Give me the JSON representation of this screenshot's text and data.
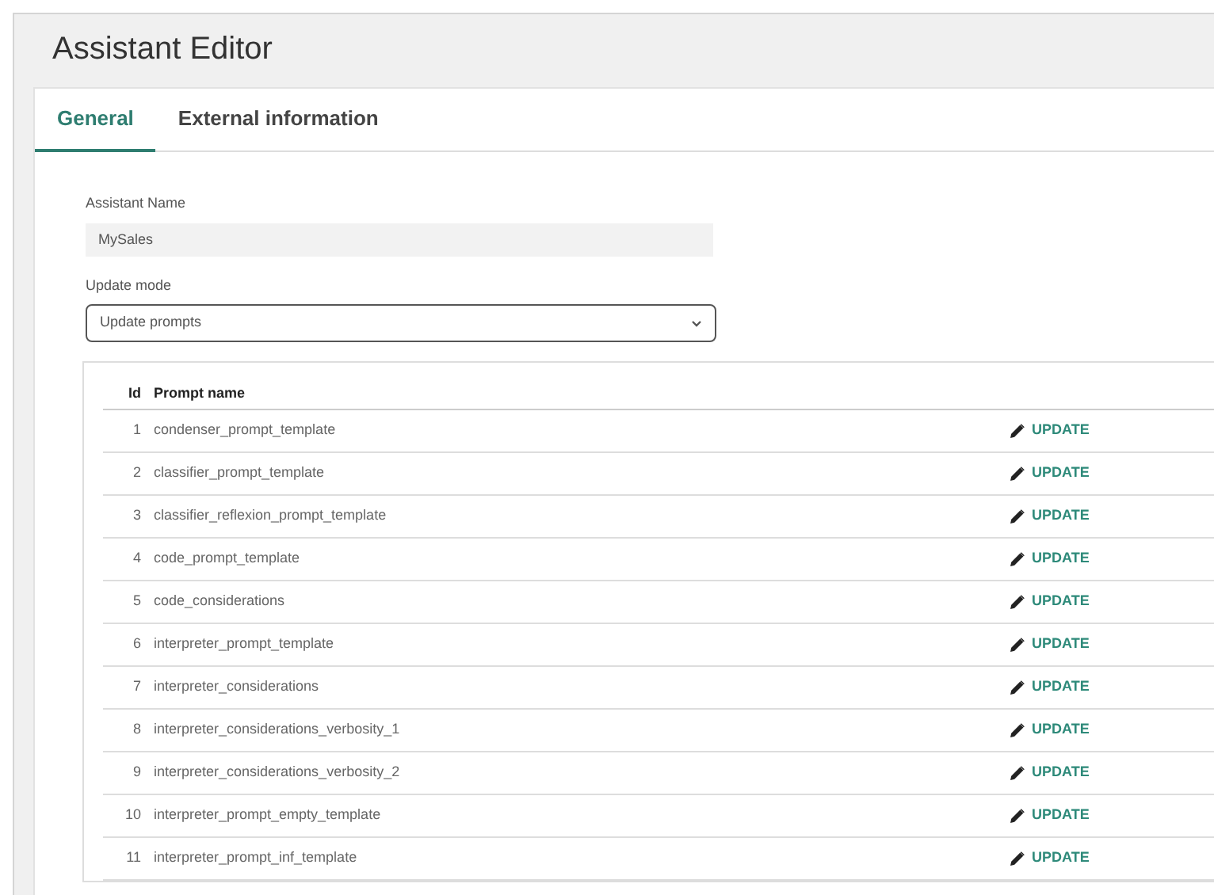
{
  "page": {
    "title": "Assistant Editor"
  },
  "tabs": [
    {
      "label": "General",
      "selected": true
    },
    {
      "label": "External information",
      "selected": false
    }
  ],
  "assistant_name": {
    "label": "Assistant Name",
    "value": "MySales"
  },
  "update_mode": {
    "label": "Update mode",
    "value": "Update prompts"
  },
  "table": {
    "columns": [
      "Id",
      "Prompt name"
    ],
    "rows": [
      {
        "id": "1",
        "name": "condenser_prompt_template",
        "action": "UPDATE"
      },
      {
        "id": "2",
        "name": "classifier_prompt_template",
        "action": "UPDATE"
      },
      {
        "id": "3",
        "name": "classifier_reflexion_prompt_template",
        "action": "UPDATE"
      },
      {
        "id": "4",
        "name": "code_prompt_template",
        "action": "UPDATE"
      },
      {
        "id": "5",
        "name": "code_considerations",
        "action": "UPDATE"
      },
      {
        "id": "6",
        "name": "interpreter_prompt_template",
        "action": "UPDATE"
      },
      {
        "id": "7",
        "name": "interpreter_considerations",
        "action": "UPDATE"
      },
      {
        "id": "8",
        "name": "interpreter_considerations_verbosity_1",
        "action": "UPDATE"
      },
      {
        "id": "9",
        "name": "interpreter_considerations_verbosity_2",
        "action": "UPDATE"
      },
      {
        "id": "10",
        "name": "interpreter_prompt_empty_template",
        "action": "UPDATE"
      },
      {
        "id": "11",
        "name": "interpreter_prompt_inf_template",
        "action": "UPDATE"
      }
    ]
  }
}
